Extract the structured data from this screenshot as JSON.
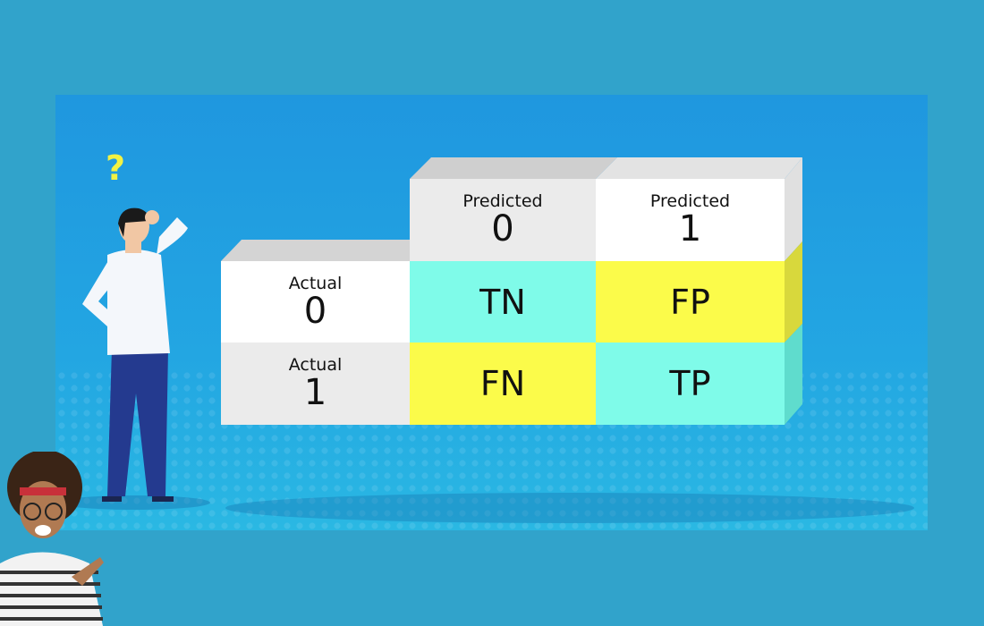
{
  "matrix": {
    "column_headers": [
      {
        "label": "Predicted",
        "value": "0"
      },
      {
        "label": "Predicted",
        "value": "1"
      }
    ],
    "row_headers": [
      {
        "label": "Actual",
        "value": "0"
      },
      {
        "label": "Actual",
        "value": "1"
      }
    ],
    "cells": [
      [
        "TN",
        "FP"
      ],
      [
        "FN",
        "TP"
      ]
    ],
    "colors": {
      "true": "#7ffbe9",
      "false": "#fbfb4a",
      "header_light": "#ffffff",
      "header_gray": "#ebebeb"
    }
  },
  "figure": {
    "question_mark": "?"
  }
}
